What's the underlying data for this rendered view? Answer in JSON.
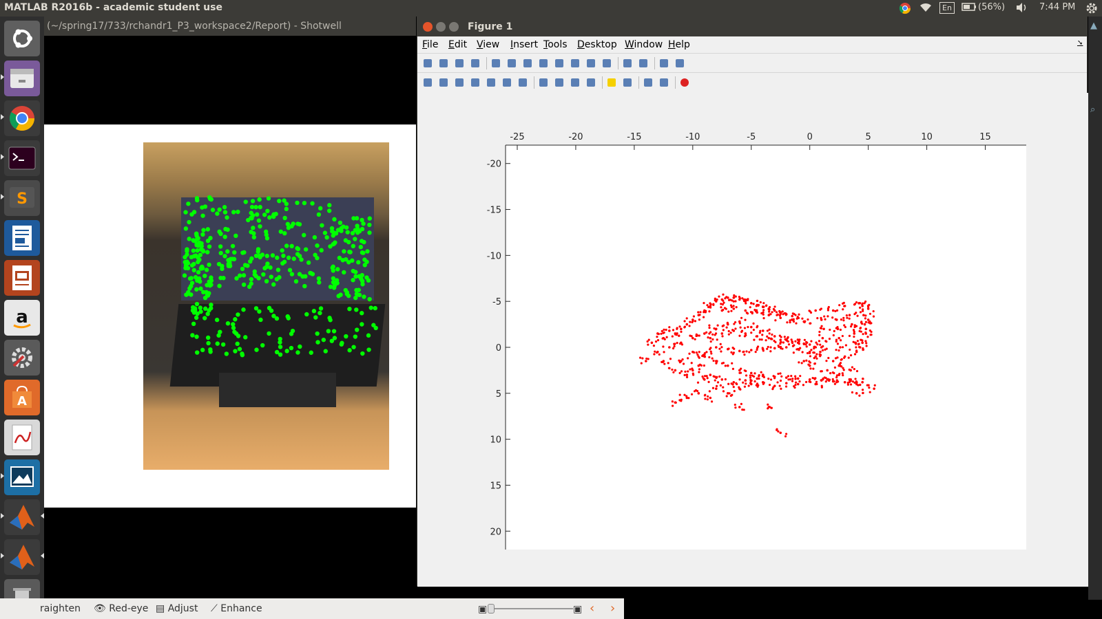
{
  "top_panel": {
    "title": "MATLAB R2016b - academic student use",
    "lang": "En",
    "battery": "(56%)",
    "time": "7:44 PM"
  },
  "launcher": {
    "items": [
      "ubuntu-dash",
      "files",
      "chrome",
      "terminal",
      "sublime-text",
      "writer",
      "impress",
      "amazon",
      "system-settings",
      "software-center",
      "document-viewer",
      "shotwell",
      "matlab",
      "matlab"
    ]
  },
  "shotwell": {
    "title": "(~/spring17/733/rchandr1_P3_workspace2/Report) - Shotwell",
    "tools": [
      "raighten",
      "Red-eye",
      "Adjust",
      "Enhance"
    ]
  },
  "figure": {
    "title": "Figure 1",
    "menu": [
      "File",
      "Edit",
      "View",
      "Insert",
      "Tools",
      "Desktop",
      "Window",
      "Help"
    ],
    "toolbar_icons": [
      "new-icon",
      "open-icon",
      "save-icon",
      "print-icon",
      "pointer-icon",
      "zoom-in-icon",
      "zoom-out-icon",
      "pan-icon",
      "rotate-icon",
      "data-cursor-icon",
      "brush-icon",
      "link-icon",
      "colorbar-icon",
      "legend-icon",
      "hide-plot-tools-icon",
      "show-plot-tools-icon"
    ],
    "toolbar2_icons": [
      "tool-1-icon",
      "tool-2-icon",
      "tool-3-icon",
      "tool-4-icon",
      "tool-5-icon",
      "tool-6-icon",
      "tool-7-icon",
      "tool-8-icon",
      "tool-9-icon",
      "tool-10-icon",
      "tool-11-icon",
      "light-icon",
      "tool-13-icon",
      "tool-14-icon",
      "tool-15-icon",
      "stop-icon"
    ]
  },
  "colors": {
    "points": "#ff0000",
    "features": "#00ff00",
    "panel": "#3c3b37"
  },
  "chart_data": {
    "type": "scatter",
    "title": "",
    "xlabel": "",
    "ylabel": "",
    "xlim": [
      -26,
      18.5
    ],
    "ylim": [
      -22,
      22
    ],
    "y_reversed": true,
    "x_axis_location": "top",
    "grid": false,
    "xticks": [
      -25,
      -20,
      -15,
      -10,
      -5,
      0,
      5,
      10,
      15
    ],
    "yticks": [
      -20,
      -15,
      -10,
      -5,
      0,
      5,
      10,
      15,
      20
    ],
    "xtick_labels": [
      "-25",
      "-20",
      "-15",
      "-10",
      "-5",
      "0",
      "5",
      "10",
      "15"
    ],
    "ytick_labels": [
      "-20",
      "-15",
      "-10",
      "-5",
      "0",
      "5",
      "10",
      "15",
      "20"
    ],
    "series": [
      {
        "values": [
          [
            -13.5,
            -0.5
          ],
          [
            -13.0,
            0.5
          ],
          [
            -12.5,
            -1.0
          ],
          [
            -12.0,
            0.0
          ],
          [
            -11.5,
            -1.5
          ],
          [
            -11.0,
            -2.0
          ],
          [
            -10.5,
            -2.5
          ],
          [
            -10.0,
            -3.0
          ],
          [
            -9.5,
            -3.5
          ],
          [
            -9.0,
            -4.0
          ],
          [
            -8.5,
            -4.5
          ],
          [
            -8.0,
            -5.0
          ],
          [
            -7.5,
            -5.2
          ],
          [
            -7.0,
            -5.4
          ],
          [
            -6.5,
            -5.4
          ],
          [
            -6.0,
            -5.2
          ],
          [
            -5.5,
            -5.0
          ],
          [
            -5.0,
            -4.8
          ],
          [
            -4.5,
            -4.6
          ],
          [
            -4.0,
            -4.4
          ],
          [
            -3.5,
            -4.2
          ],
          [
            -3.0,
            -4.0
          ],
          [
            -2.5,
            -3.8
          ],
          [
            -2.0,
            -3.6
          ],
          [
            -1.5,
            -3.4
          ],
          [
            -1.0,
            -3.2
          ],
          [
            -10.0,
            -1.0
          ],
          [
            -9.0,
            -1.5
          ],
          [
            -8.0,
            -2.0
          ],
          [
            -7.0,
            -2.5
          ],
          [
            -6.0,
            -2.8
          ],
          [
            -5.0,
            -2.2
          ],
          [
            -4.0,
            -1.8
          ],
          [
            -3.0,
            -1.2
          ],
          [
            -2.0,
            -0.8
          ],
          [
            -1.0,
            -0.5
          ],
          [
            0.0,
            -0.3
          ],
          [
            -8.0,
            0.0
          ],
          [
            -7.0,
            0.2
          ],
          [
            -6.0,
            0.4
          ],
          [
            -5.0,
            0.3
          ],
          [
            -4.0,
            0.2
          ],
          [
            -3.0,
            0.1
          ],
          [
            -2.0,
            0.0
          ],
          [
            -1.0,
            0.2
          ],
          [
            0.0,
            0.5
          ],
          [
            -9.0,
            1.0
          ],
          [
            -8.0,
            1.5
          ],
          [
            -7.0,
            2.0
          ],
          [
            -6.0,
            2.5
          ],
          [
            -5.0,
            2.8
          ],
          [
            -4.0,
            3.0
          ],
          [
            -3.0,
            3.2
          ],
          [
            -2.0,
            3.3
          ],
          [
            -1.0,
            3.4
          ],
          [
            0.0,
            3.5
          ],
          [
            1.0,
            3.6
          ],
          [
            2.0,
            3.7
          ],
          [
            3.0,
            3.8
          ],
          [
            -11.0,
            1.5
          ],
          [
            -10.0,
            2.5
          ],
          [
            -9.0,
            3.5
          ],
          [
            -8.0,
            4.5
          ],
          [
            -9.5,
            5.0
          ],
          [
            -10.5,
            5.5
          ],
          [
            -11.5,
            6.0
          ],
          [
            -8.5,
            5.5
          ],
          [
            -7.0,
            5.0
          ],
          [
            -6.0,
            4.5
          ],
          [
            -5.0,
            4.0
          ],
          [
            -4.0,
            3.8
          ],
          [
            -3.0,
            4.2
          ],
          [
            -2.0,
            3.9
          ],
          [
            -1.0,
            4.0
          ],
          [
            0.5,
            4.0
          ],
          [
            1.5,
            3.5
          ],
          [
            2.5,
            3.0
          ],
          [
            3.5,
            3.5
          ],
          [
            4.0,
            4.0
          ],
          [
            4.5,
            3.8
          ],
          [
            0.5,
            -4.0
          ],
          [
            1.0,
            -3.0
          ],
          [
            1.2,
            -2.0
          ],
          [
            1.1,
            -1.0
          ],
          [
            1.0,
            0.0
          ],
          [
            0.9,
            0.5
          ],
          [
            2.0,
            -4.0
          ],
          [
            2.3,
            -3.0
          ],
          [
            2.4,
            -2.0
          ],
          [
            2.5,
            -1.0
          ],
          [
            2.6,
            0.0
          ],
          [
            3.0,
            -4.5
          ],
          [
            3.4,
            -3.5
          ],
          [
            3.6,
            -2.5
          ],
          [
            3.8,
            -1.5
          ],
          [
            3.9,
            -0.5
          ],
          [
            4.0,
            0.5
          ],
          [
            4.2,
            -4.8
          ],
          [
            4.5,
            -4.5
          ],
          [
            4.6,
            -3.5
          ],
          [
            4.7,
            -2.5
          ],
          [
            4.8,
            -1.5
          ],
          [
            4.5,
            -0.5
          ],
          [
            4.3,
            0.0
          ],
          [
            5.0,
            -4.2
          ],
          [
            5.0,
            -3.0
          ],
          [
            4.8,
            -2.0
          ],
          [
            -13.0,
            -1.5
          ],
          [
            -12.5,
            1.5
          ],
          [
            -14.0,
            1.5
          ],
          [
            -6.0,
            6.5
          ],
          [
            -3.5,
            6.5
          ],
          [
            -2.5,
            9.3
          ],
          [
            5.5,
            4.5
          ],
          [
            4.0,
            5.0
          ],
          [
            -12.0,
            -1.8
          ],
          [
            -11.0,
            -0.5
          ],
          [
            -10.0,
            0.5
          ],
          [
            -9.0,
            0.8
          ],
          [
            -8.5,
            -1.0
          ],
          [
            -7.5,
            -1.5
          ],
          [
            -6.5,
            -1.8
          ],
          [
            -5.5,
            -1.5
          ],
          [
            -4.5,
            -1.2
          ],
          [
            -3.5,
            -1.0
          ],
          [
            -2.5,
            -0.8
          ],
          [
            -1.5,
            -0.6
          ],
          [
            -0.5,
            -0.4
          ],
          [
            -7.5,
            -4.0
          ],
          [
            -6.5,
            -4.2
          ],
          [
            -5.5,
            -4.0
          ],
          [
            -4.5,
            -3.8
          ],
          [
            -3.5,
            -3.5
          ],
          [
            -2.5,
            -3.2
          ],
          [
            -1.5,
            -3.0
          ],
          [
            -0.5,
            -2.8
          ],
          [
            -11.5,
            2.5
          ],
          [
            -10.5,
            3.0
          ],
          [
            -9.5,
            2.0
          ],
          [
            -8.5,
            3.0
          ],
          [
            -7.5,
            3.5
          ],
          [
            -6.5,
            3.8
          ],
          [
            -5.5,
            3.6
          ],
          [
            -4.5,
            3.4
          ],
          [
            0.0,
            2.0
          ],
          [
            0.5,
            1.0
          ],
          [
            1.5,
            2.5
          ],
          [
            2.5,
            2.0
          ],
          [
            3.5,
            2.5
          ],
          [
            3.0,
            1.0
          ],
          [
            2.0,
            1.5
          ],
          [
            -0.5,
            1.5
          ]
        ]
      }
    ]
  }
}
